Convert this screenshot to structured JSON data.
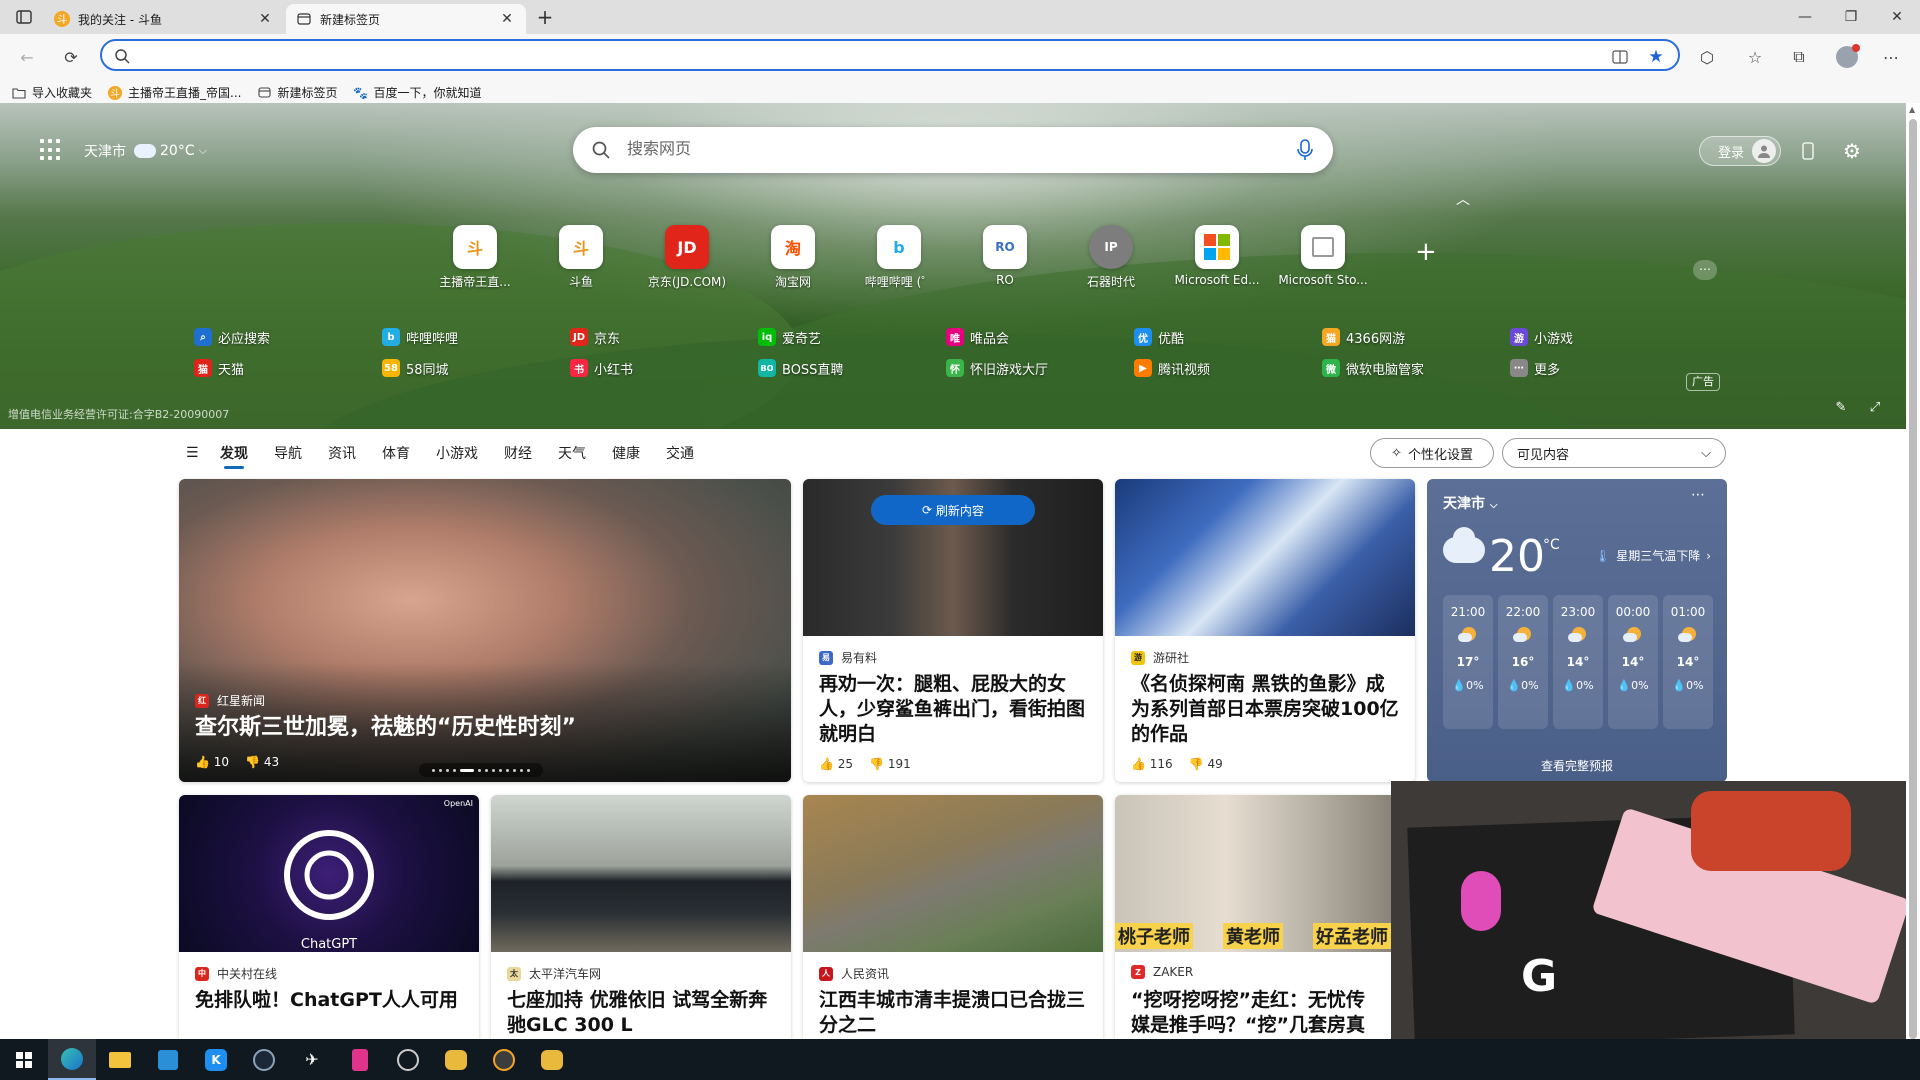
{
  "tabs": [
    {
      "title": "我的关注 - 斗鱼",
      "active": false
    },
    {
      "title": "新建标签页",
      "active": true
    }
  ],
  "address": {
    "value": "",
    "placeholder": ""
  },
  "bookmarks": [
    {
      "label": "导入收藏夹",
      "icon": "folder-import-icon"
    },
    {
      "label": "主播帝王直播_帝国...",
      "icon": "douyu-icon"
    },
    {
      "label": "新建标签页",
      "icon": "newtab-icon"
    },
    {
      "label": "百度一下，你就知道",
      "icon": "baidu-icon"
    }
  ],
  "hero": {
    "city": "天津市",
    "temp": "20°C",
    "search_placeholder": "搜索网页",
    "login_label": "登录",
    "license": "增值电信业务经营许可证:合字B2-20090007"
  },
  "quicklinks": [
    {
      "name": "主播帝王直...",
      "glyph": "斗",
      "color": "#e8951c"
    },
    {
      "name": "斗鱼",
      "glyph": "斗",
      "color": "#e8951c"
    },
    {
      "name": "京东(JD.COM)",
      "glyph": "JD",
      "color": "#e1251b"
    },
    {
      "name": "淘宝网",
      "glyph": "淘",
      "color": "#ff5000"
    },
    {
      "name": "哔哩哔哩 (゜",
      "glyph": "b",
      "color": "#23ade5"
    },
    {
      "name": "RO",
      "glyph": "RO",
      "color": "#3b6fc4"
    },
    {
      "name": "石器时代",
      "glyph": "IP",
      "color": "#666666"
    },
    {
      "name": "Microsoft Ed...",
      "glyph": "ms",
      "color": "#f25022"
    },
    {
      "name": "Microsoft Sto...",
      "glyph": "st",
      "color": "#999999"
    }
  ],
  "links_row1": [
    {
      "label": "必应搜索",
      "color": "#1f6fd1",
      "glyph": "b"
    },
    {
      "label": "哔哩哔哩",
      "color": "#23ade5",
      "glyph": "b"
    },
    {
      "label": "京东",
      "color": "#e1251b",
      "glyph": "JD"
    },
    {
      "label": "爱奇艺",
      "color": "#00be06",
      "glyph": "iq"
    },
    {
      "label": "唯品会",
      "color": "#e4007f",
      "glyph": "唯"
    },
    {
      "label": "优酷",
      "color": "#1e8ff0",
      "glyph": "优"
    },
    {
      "label": "4366网游",
      "color": "#f5a623",
      "glyph": "猫"
    },
    {
      "label": "小游戏",
      "color": "#6a4ad8",
      "glyph": "游"
    }
  ],
  "links_row2": [
    {
      "label": "天猫",
      "color": "#e2231a",
      "glyph": "猫"
    },
    {
      "label": "58同城",
      "color": "#f7b500",
      "glyph": "58"
    },
    {
      "label": "小红书",
      "color": "#ff2442",
      "glyph": "书"
    },
    {
      "label": "BOSS直聘",
      "color": "#11b7a4",
      "glyph": "BO"
    },
    {
      "label": "怀旧游戏大厅",
      "color": "#39b54a",
      "glyph": "怀"
    },
    {
      "label": "腾讯视频",
      "color": "#ff7c00",
      "glyph": "▶"
    },
    {
      "label": "微软电脑管家",
      "color": "#2fb44a",
      "glyph": "微"
    },
    {
      "label": "更多",
      "color": "#888888",
      "glyph": "⋯"
    }
  ],
  "ad_label": "广告",
  "feed_nav": [
    "发现",
    "导航",
    "资讯",
    "体育",
    "小游戏",
    "财经",
    "天气",
    "健康",
    "交通"
  ],
  "personal_label": "个性化设置",
  "visible_label": "可见内容",
  "cards": {
    "hero": {
      "source": "红星新闻",
      "headline": "查尔斯三世加冕，祛魅的“历史性时刻”",
      "likes": "10",
      "dislikes": "43"
    },
    "c2": {
      "refresh": "刷新内容",
      "source": "易有料",
      "headline": "再劝一次：腿粗、屁股大的女人，少穿鲨鱼裤出门，看街拍图就明白",
      "likes": "25",
      "dislikes": "191"
    },
    "c3": {
      "source": "游研社",
      "headline": "《名侦探柯南 黑铁的鱼影》成为系列首部日本票房突破100亿的作品",
      "likes": "116",
      "dislikes": "49"
    },
    "c4": {
      "source": "中关村在线",
      "headline": "免排队啦！ChatGPT人人可用",
      "badge": "OpenAI",
      "img_text": "ChatGPT"
    },
    "c5": {
      "source": "太平洋汽车网",
      "headline": "七座加持 优雅依旧 试驾全新奔驰GLC 300 L"
    },
    "c6": {
      "source": "人民资讯",
      "headline": "江西丰城市清丰提溃口已合拢三分之二"
    },
    "c7": {
      "source": "ZAKER",
      "headline": "“挖呀挖呀挖”走红：无忧传媒是推手吗？“挖”几套房真实",
      "img_captions": [
        "桃子老师",
        "黄老师",
        "好孟老师"
      ]
    }
  },
  "weather": {
    "city": "天津市",
    "temp": "20",
    "unit": "°C",
    "alert": "星期三气温下降",
    "hours": [
      {
        "time": "21:00",
        "temp": "17°",
        "precip": "0%"
      },
      {
        "time": "22:00",
        "temp": "16°",
        "precip": "0%"
      },
      {
        "time": "23:00",
        "temp": "14°",
        "precip": "0%"
      },
      {
        "time": "00:00",
        "temp": "14°",
        "precip": "0%"
      },
      {
        "time": "01:00",
        "temp": "14°",
        "precip": "0%"
      }
    ],
    "forecast_link": "查看完整预报"
  },
  "colors": {
    "accent": "#0f6cbd",
    "address_border": "#2b6fdc",
    "weather_bg": "#55688f"
  }
}
